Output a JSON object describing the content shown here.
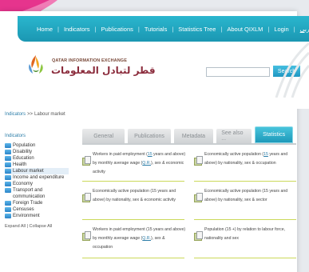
{
  "nav": {
    "items": [
      "Home",
      "Indicators",
      "Publications",
      "Tutorials",
      "Statistics Tree",
      "About QIXLM",
      "Login",
      "عربي"
    ]
  },
  "header": {
    "logo_en": "QATAR INFORMATION EXCHANGE",
    "logo_ar": "قطر لتبادل المعلومات",
    "search_placeholder": "",
    "search_label": "Search"
  },
  "breadcrumb": {
    "parent": "Indicators",
    "sep": ">>",
    "current": "Labour market"
  },
  "sidebar": {
    "title": "Indicators",
    "items": [
      {
        "label": "Population",
        "active": false
      },
      {
        "label": "Disability",
        "active": false
      },
      {
        "label": "Education",
        "active": false
      },
      {
        "label": "Health",
        "active": false
      },
      {
        "label": "Labour market",
        "active": true
      },
      {
        "label": "Income and expenditure",
        "active": false
      },
      {
        "label": "Economy",
        "active": false
      },
      {
        "label": "Transport and communication",
        "active": false
      },
      {
        "label": "Foreign Trade",
        "active": false
      },
      {
        "label": "Censuses",
        "active": false
      },
      {
        "label": "Environment",
        "active": false
      }
    ],
    "expand_all": "Expand All",
    "collapse_all": "Collapse All",
    "foot_sep": "|"
  },
  "tabs": [
    "General",
    "Publications",
    "Metadata",
    "See also ...",
    "Statistics"
  ],
  "reports": [
    {
      "pre": "Workers in paid employment (",
      "u": "15",
      "post": " years and above) by monthly average wage (",
      "u2": "Q.R.",
      "post2": "), sex & economic activity"
    },
    {
      "pre": "Economically active population (",
      "u": "15",
      "post": " years and above) by nationality, sex & occupation",
      "u2": "",
      "post2": ""
    },
    {
      "pre": "Economically active population (15 years and above) by nationality, sex & economic activity",
      "u": "",
      "post": "",
      "u2": "",
      "post2": ""
    },
    {
      "pre": "Economically active population (15 years and above) by nationality, sex & sector",
      "u": "",
      "post": "",
      "u2": "",
      "post2": ""
    },
    {
      "pre": "Workers in paid employment (15 years and above) by monthly average wage (",
      "u": "Q.R.",
      "post": "), sex & occupation",
      "u2": "",
      "post2": ""
    },
    {
      "pre": "Population (15 +) by relation to labour force, nationality and sex",
      "u": "",
      "post": "",
      "u2": "",
      "post2": ""
    }
  ],
  "colors": {
    "nav": "#1fa8c4",
    "accent": "#2c7da8",
    "tab_active": "#2ab6ce",
    "separator": "#cbd95a",
    "swoosh": "#e6348d"
  }
}
